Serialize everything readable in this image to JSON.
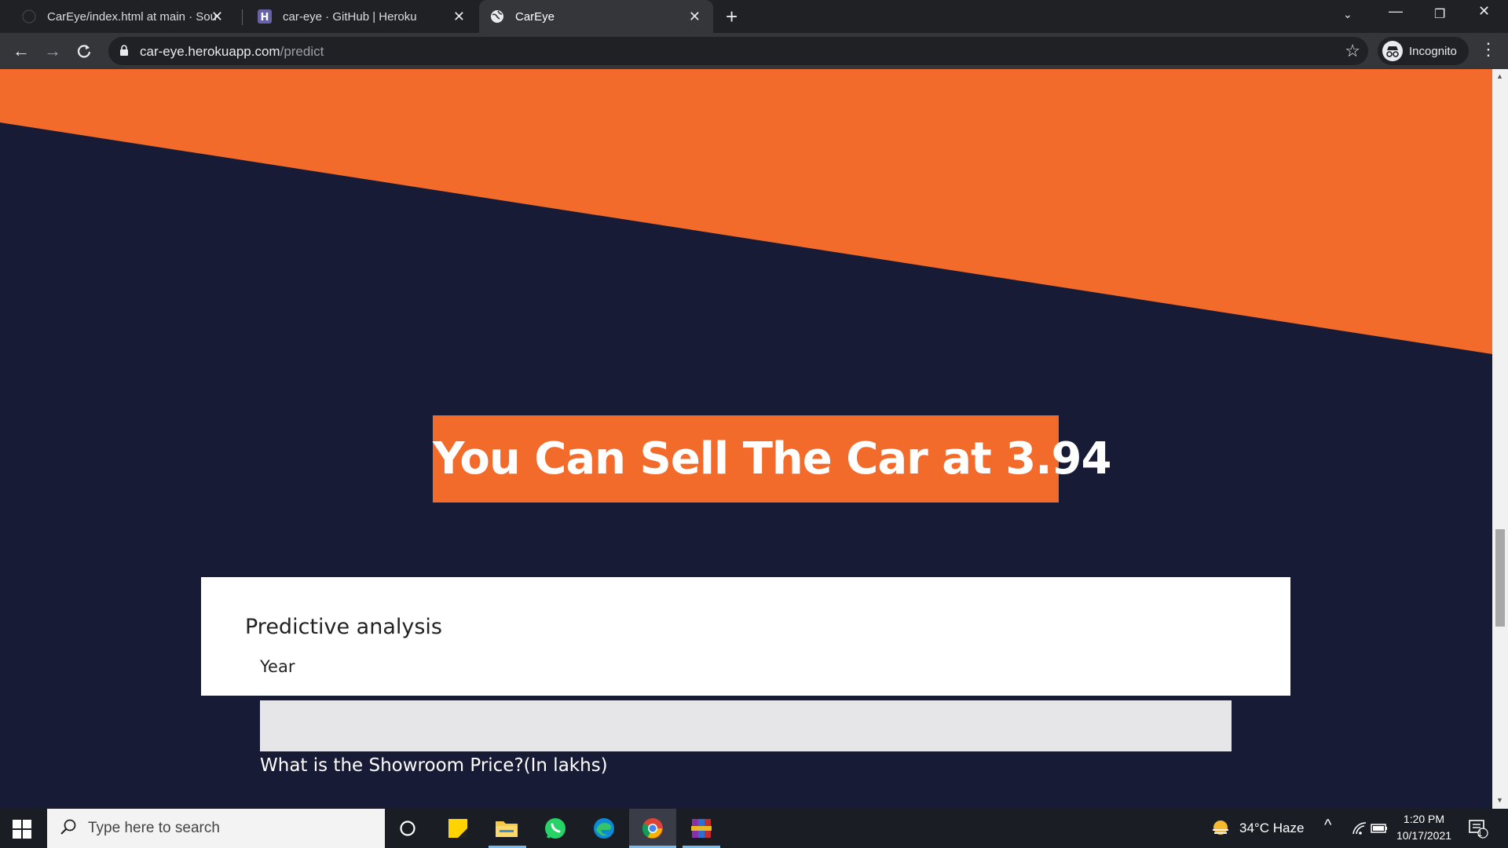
{
  "browser": {
    "tabs": [
      {
        "title": "CarEye/index.html at main · Sour",
        "icon": "github-icon"
      },
      {
        "title": "car-eye · GitHub | Heroku",
        "icon": "heroku-icon"
      },
      {
        "title": "CarEye",
        "icon": "globe-icon",
        "active": true
      }
    ],
    "url_host": "car-eye.herokuapp.com",
    "url_path": "/predict",
    "profile_label": "Incognito"
  },
  "page": {
    "result_text": "You Can Sell The Car at 3.94",
    "card_title": "Predictive analysis",
    "year_label": "Year",
    "year_value": "",
    "showroom_question": "What is the Showroom Price?(In lakhs)",
    "colors": {
      "orange": "#f26b2b",
      "navy": "#181b36"
    }
  },
  "taskbar": {
    "search_placeholder": "Type here to search",
    "apps": [
      "cortana-icon",
      "sticky-notes-icon",
      "file-explorer-icon",
      "whatsapp-icon",
      "edge-icon",
      "chrome-icon",
      "winrar-icon"
    ],
    "weather": "34°C  Haze",
    "time": "1:20 PM",
    "date": "10/17/2021",
    "notifications": "1"
  }
}
